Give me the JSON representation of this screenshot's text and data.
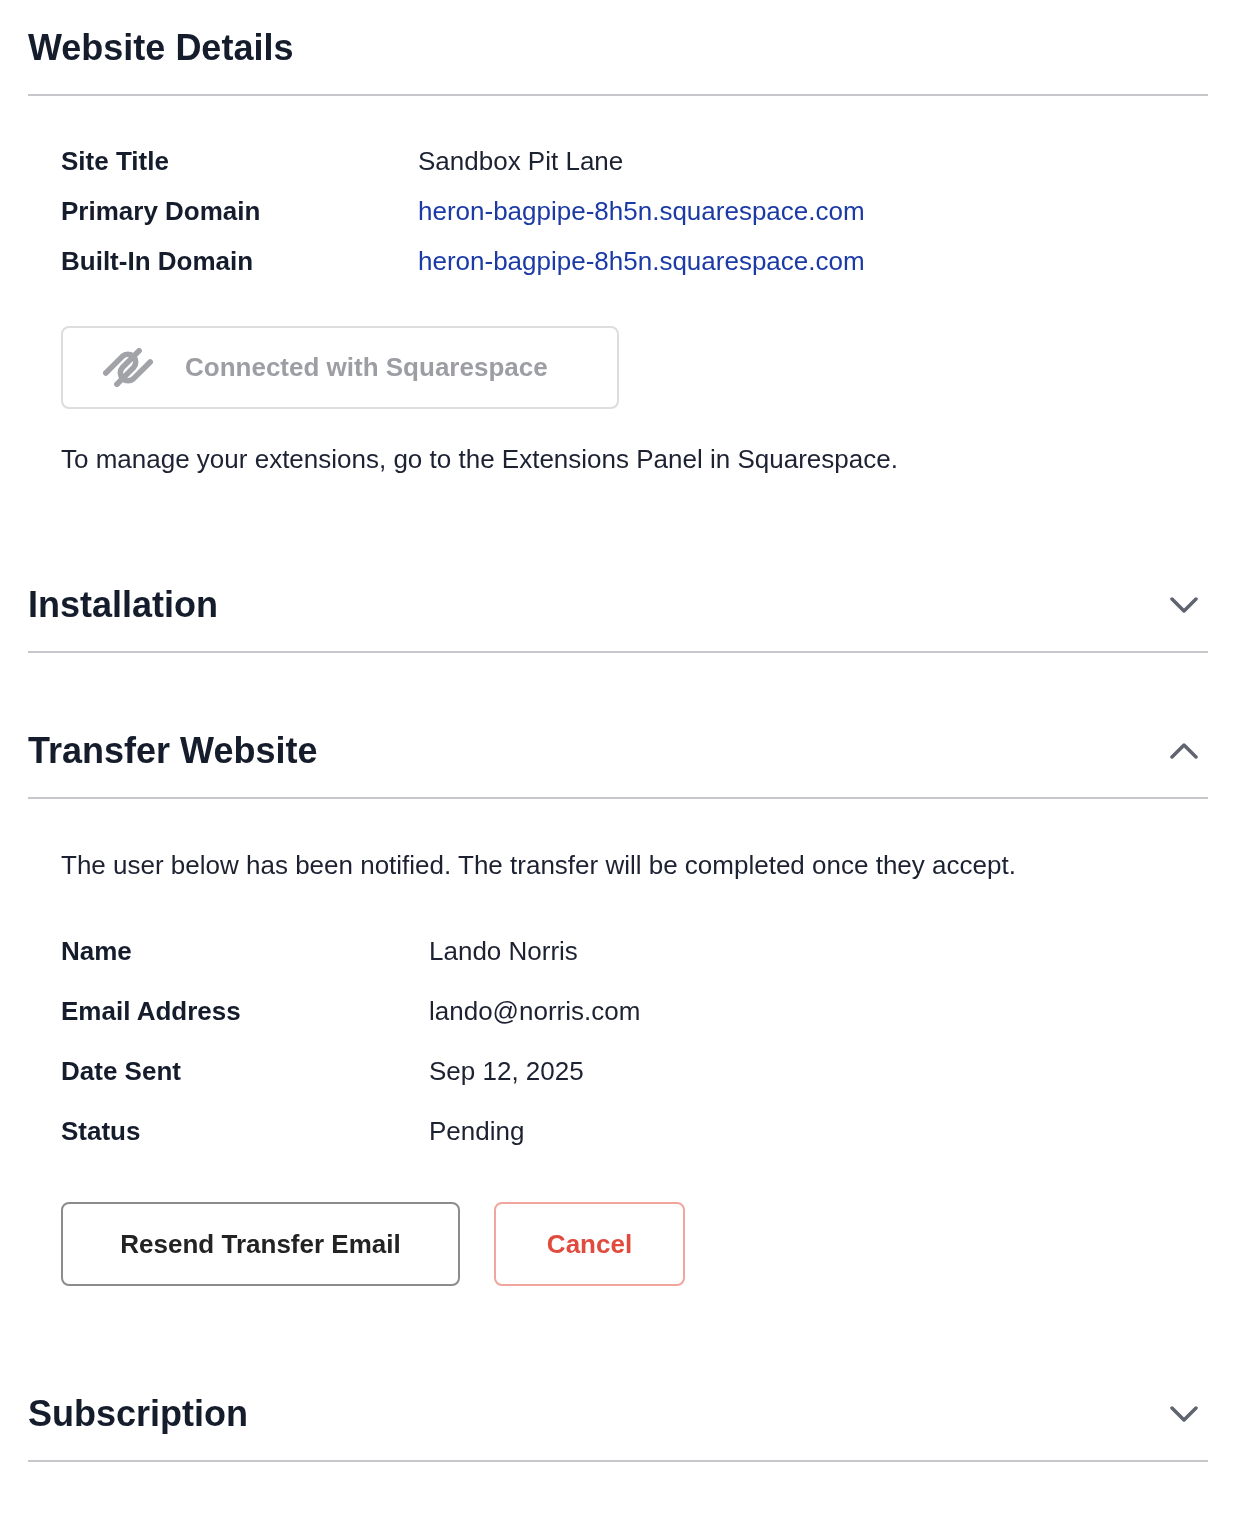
{
  "sections": [
    {
      "kind": "details",
      "title": "Website Details",
      "rows": [
        {
          "label": "Site Title",
          "value": "Sandbox Pit Lane",
          "kind": "text"
        },
        {
          "label": "Primary Domain",
          "value": "heron-bagpipe-8h5n.squarespace.com",
          "kind": "link"
        },
        {
          "label": "Built-In Domain",
          "value": "heron-bagpipe-8h5n.squarespace.com",
          "kind": "link"
        }
      ],
      "connect_button": {
        "label": "Connected with Squarespace",
        "disabled": true
      },
      "note": "To manage your extensions, go to the Extensions Panel in Squarespace."
    },
    {
      "kind": "accordion",
      "title": "Installation",
      "expanded": false
    },
    {
      "kind": "accordion",
      "title": "Transfer Website",
      "expanded": true,
      "message": "The user below has been notified. The transfer will be completed once they accept.",
      "rows": [
        {
          "label": "Name",
          "value": "Lando Norris",
          "kind": "text"
        },
        {
          "label": "Email Address",
          "value": "lando@norris.com",
          "kind": "text"
        },
        {
          "label": "Date Sent",
          "value": "Sep 12, 2025",
          "kind": "text"
        },
        {
          "label": "Status",
          "value": "Pending",
          "kind": "text"
        }
      ],
      "buttons": [
        {
          "label": "Resend Transfer Email",
          "kind": "secondary"
        },
        {
          "label": "Cancel",
          "kind": "danger"
        }
      ]
    },
    {
      "kind": "accordion",
      "title": "Subscription",
      "expanded": false
    }
  ]
}
